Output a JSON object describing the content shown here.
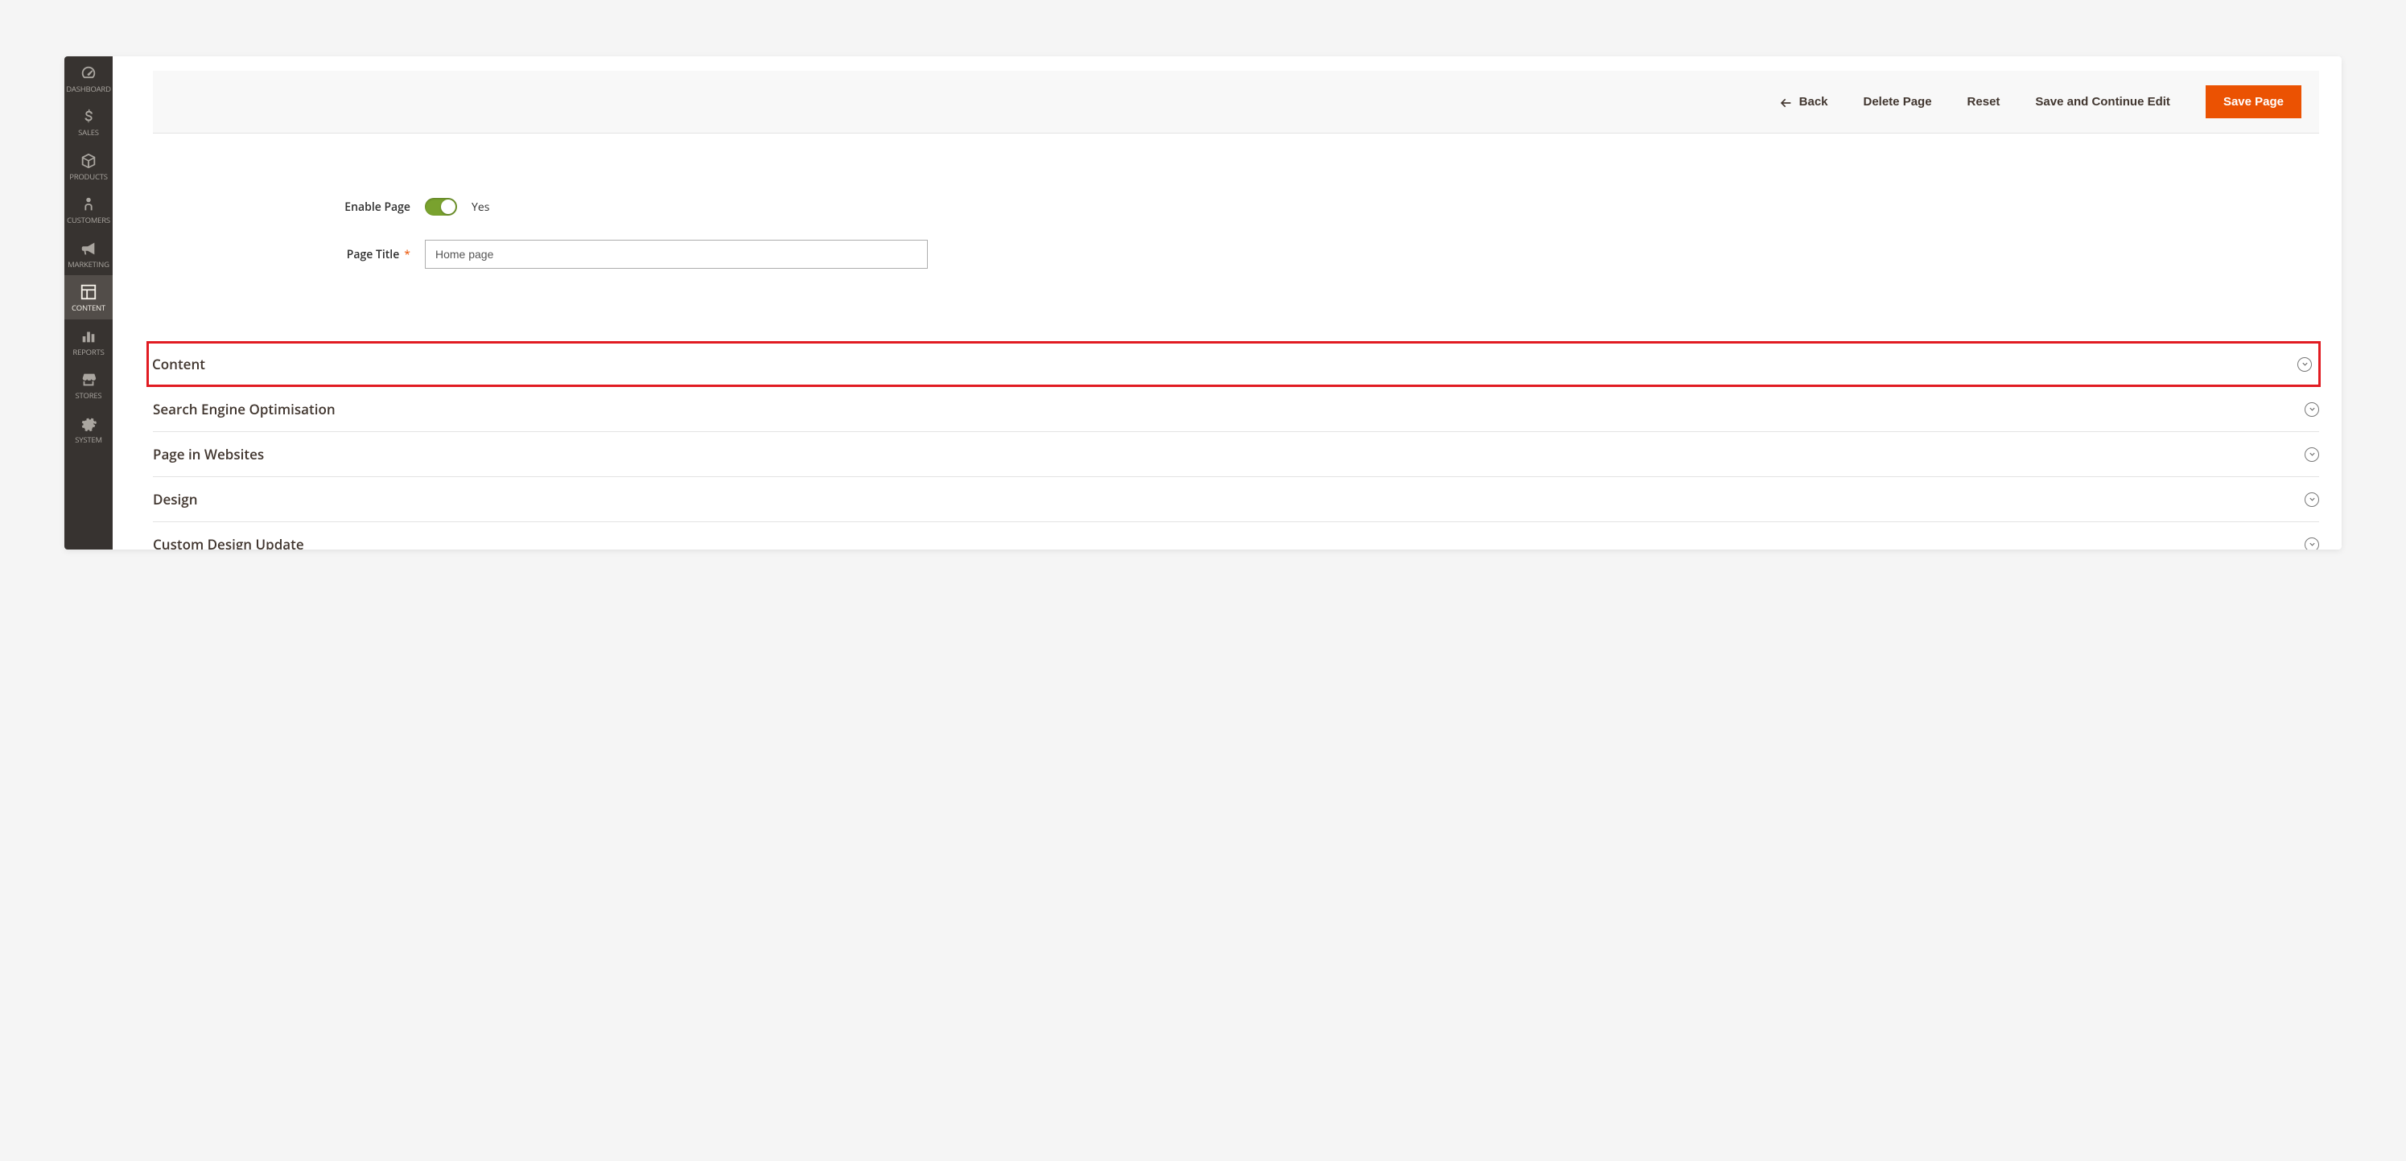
{
  "sidebar": {
    "items": [
      {
        "label": "DASHBOARD",
        "icon": "gauge"
      },
      {
        "label": "SALES",
        "icon": "dollar"
      },
      {
        "label": "PRODUCTS",
        "icon": "box"
      },
      {
        "label": "CUSTOMERS",
        "icon": "person"
      },
      {
        "label": "MARKETING",
        "icon": "megaphone"
      },
      {
        "label": "CONTENT",
        "icon": "layout"
      },
      {
        "label": "REPORTS",
        "icon": "chart"
      },
      {
        "label": "STORES",
        "icon": "storefront"
      },
      {
        "label": "SYSTEM",
        "icon": "gear"
      }
    ]
  },
  "toolbar": {
    "back_label": "Back",
    "delete_label": "Delete Page",
    "reset_label": "Reset",
    "save_continue_label": "Save and Continue Edit",
    "save_label": "Save Page"
  },
  "form": {
    "enable_label": "Enable Page",
    "enable_value": "Yes",
    "title_label": "Page Title",
    "title_value": "Home page"
  },
  "sections": [
    {
      "title": "Content",
      "highlighted": true
    },
    {
      "title": "Search Engine Optimisation"
    },
    {
      "title": "Page in Websites"
    },
    {
      "title": "Design"
    },
    {
      "title": "Custom Design Update"
    }
  ]
}
